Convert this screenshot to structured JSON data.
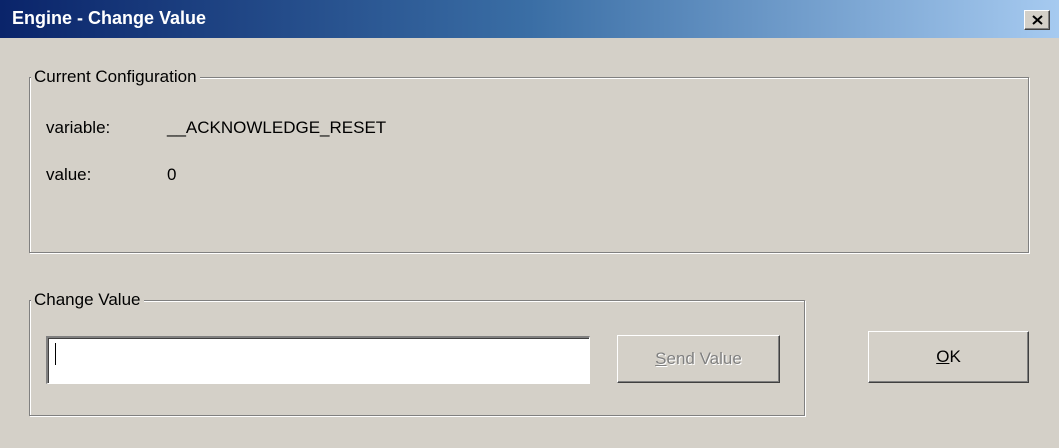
{
  "window": {
    "title": "Engine - Change Value",
    "close_label": "X"
  },
  "current_configuration": {
    "legend": "Current Configuration",
    "variable_label": "variable:",
    "variable_value": "__ACKNOWLEDGE_RESET",
    "value_label": "value:",
    "value_value": "0"
  },
  "change_value": {
    "legend": "Change Value",
    "input_value": "",
    "send_button": {
      "mnemonic": "S",
      "rest": "end Value",
      "enabled": false
    }
  },
  "ok_button": {
    "mnemonic": "O",
    "rest": "K"
  },
  "colors": {
    "face": "#d4d0c8",
    "title_start": "#0a246a",
    "title_end": "#a6caf0",
    "disabled_text": "#808080"
  }
}
